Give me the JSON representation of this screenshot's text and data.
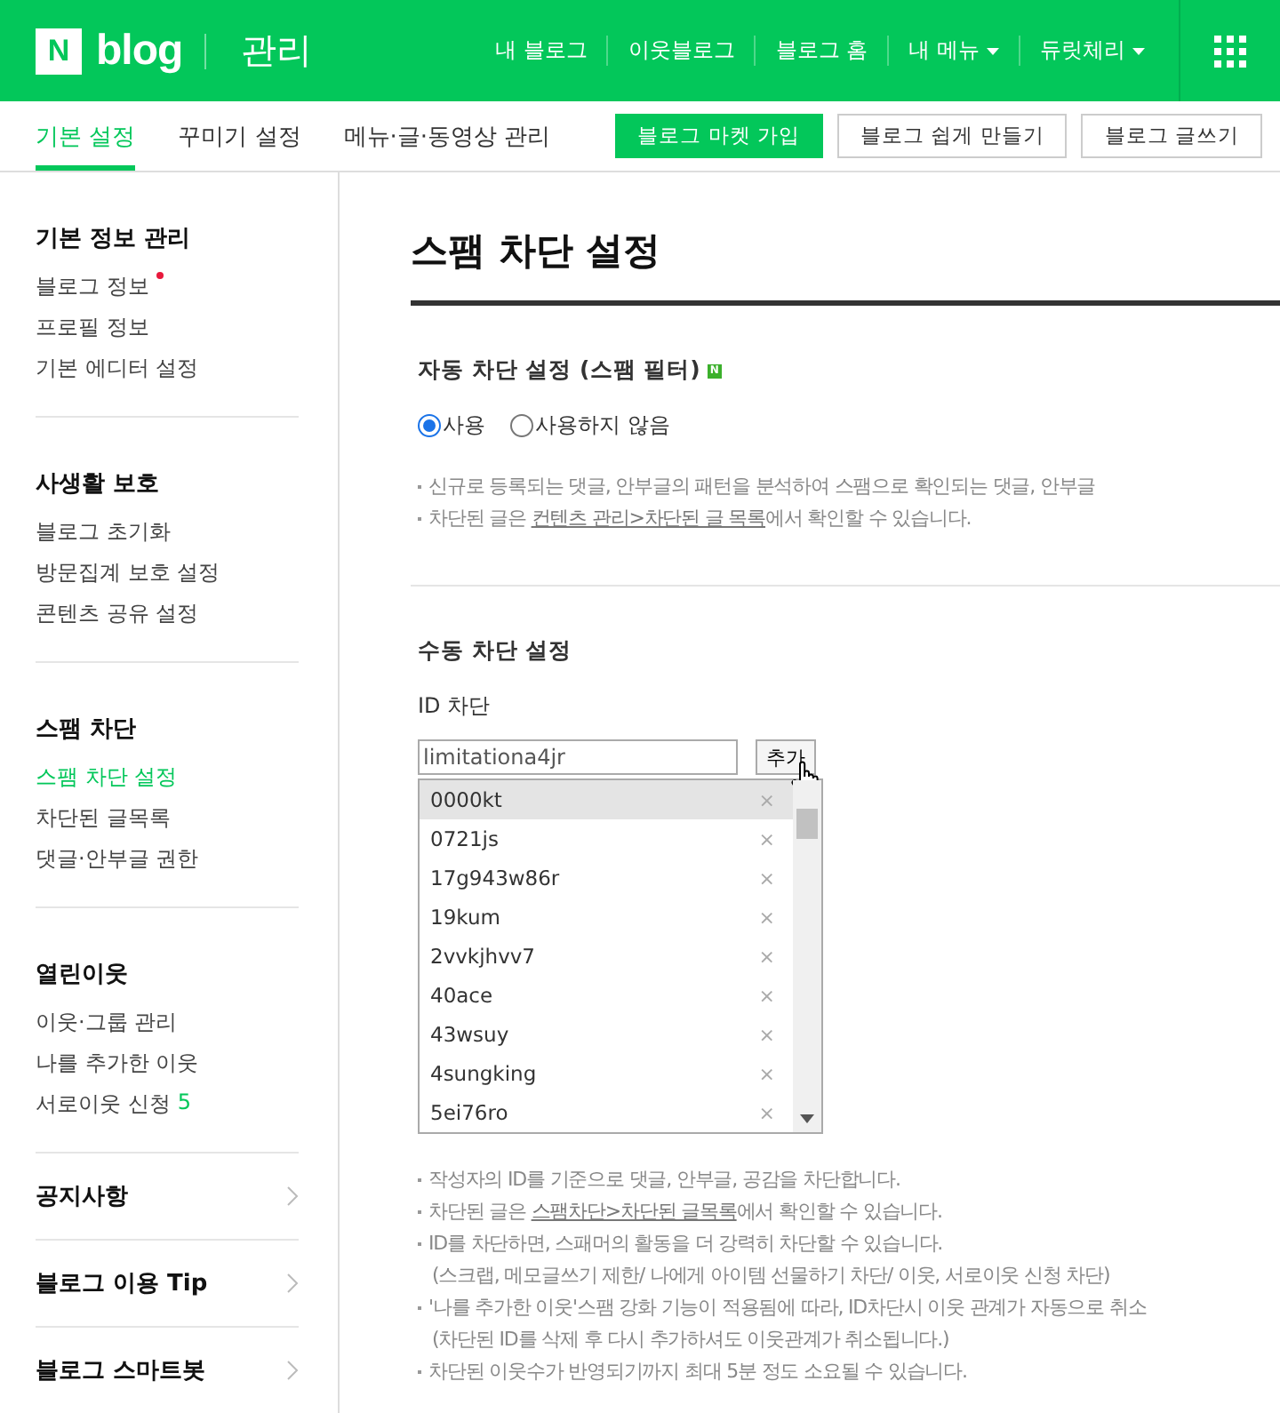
{
  "header": {
    "logo_mark": "N",
    "logo_text": "blog",
    "section": "관리",
    "links": [
      {
        "label": "내 블로그",
        "dropdown": false
      },
      {
        "label": "이웃블로그",
        "dropdown": false
      },
      {
        "label": "블로그 홈",
        "dropdown": false
      },
      {
        "label": "내 메뉴",
        "dropdown": true
      },
      {
        "label": "듀릿체리",
        "dropdown": true
      }
    ]
  },
  "tabs": [
    {
      "label": "기본 설정",
      "selected": true
    },
    {
      "label": "꾸미기 설정",
      "selected": false
    },
    {
      "label": "메뉴·글·동영상 관리",
      "selected": false
    }
  ],
  "actions": [
    {
      "label": "블로그 마켓 가입",
      "primary": true
    },
    {
      "label": "블로그 쉽게 만들기",
      "primary": false
    },
    {
      "label": "블로그 글쓰기",
      "primary": false
    }
  ],
  "sidebar": {
    "groups": [
      {
        "title": "기본 정보 관리",
        "items": [
          {
            "label": "블로그 정보",
            "selected": false,
            "new": true
          },
          {
            "label": "프로필 정보",
            "selected": false,
            "new": false
          },
          {
            "label": "기본 에디터 설정",
            "selected": false,
            "new": false
          }
        ]
      },
      {
        "title": "사생활 보호",
        "items": [
          {
            "label": "블로그 초기화",
            "selected": false,
            "new": false
          },
          {
            "label": "방문집계 보호 설정",
            "selected": false,
            "new": false
          },
          {
            "label": "콘텐츠 공유 설정",
            "selected": false,
            "new": false
          }
        ]
      },
      {
        "title": "스팸 차단",
        "items": [
          {
            "label": "스팸 차단 설정",
            "selected": true,
            "new": false
          },
          {
            "label": "차단된 글목록",
            "selected": false,
            "new": false
          },
          {
            "label": "댓글·안부글 권한",
            "selected": false,
            "new": false
          }
        ]
      },
      {
        "title": "열린이웃",
        "items": [
          {
            "label": "이웃·그룹 관리",
            "selected": false,
            "new": false
          },
          {
            "label": "나를 추가한 이웃",
            "selected": false,
            "new": false
          },
          {
            "label": "서로이웃 신청",
            "selected": false,
            "new": false,
            "count": "5"
          }
        ]
      }
    ],
    "links": [
      "공지사항",
      "블로그 이용 Tip",
      "블로그 스마트봇"
    ]
  },
  "page_title": "스팸 차단 설정",
  "auto_block": {
    "title": "자동 차단 설정 (스팸 필터)",
    "badge": "N",
    "options": [
      {
        "label": "사용",
        "selected": true
      },
      {
        "label": "사용하지 않음",
        "selected": false
      }
    ],
    "notes": [
      {
        "text": "신규로 등록되는 댓글, 안부글의 패턴을 분석하여 스팸으로 확인되는 댓글, 안부글"
      },
      {
        "text": "차단된 글은 ",
        "link": "컨텐츠 관리>차단된 글 목록",
        "after": "에서 확인할 수 있습니다."
      }
    ]
  },
  "manual_block": {
    "title": "수동 차단 설정",
    "id_label": "ID 차단",
    "input_value": "limitationa4jr",
    "add_button": "추가",
    "ids": [
      {
        "id": "0000kt",
        "selected": true
      },
      {
        "id": "0721js",
        "selected": false
      },
      {
        "id": "17g943w86r",
        "selected": false
      },
      {
        "id": "19kum",
        "selected": false
      },
      {
        "id": "2vvkjhvv7",
        "selected": false
      },
      {
        "id": "40ace",
        "selected": false
      },
      {
        "id": "43wsuy",
        "selected": false
      },
      {
        "id": "4sungking",
        "selected": false
      },
      {
        "id": "5ei76ro",
        "selected": false
      }
    ],
    "remove_glyph": "×",
    "notes": [
      {
        "kind": "bullet",
        "text": "작성자의 ID를 기준으로 댓글, 안부글, 공감을 차단합니다."
      },
      {
        "kind": "bullet",
        "text": "차단된 글은 ",
        "link": "스팸차단>차단된 글목록",
        "after": "에서 확인할 수 있습니다."
      },
      {
        "kind": "bullet",
        "text": "ID를 차단하면, 스패머의 활동을 더 강력히 차단할 수 있습니다."
      },
      {
        "kind": "continuation",
        "text": "(스크랩, 메모글쓰기 제한/ 나에게 아이템 선물하기 차단/ 이웃, 서로이웃 신청 차단)"
      },
      {
        "kind": "bullet",
        "text": "'나를 추가한 이웃'스팸 강화 기능이 적용됨에 따라, ID차단시 이웃 관계가 자동으로 취소"
      },
      {
        "kind": "continuation",
        "text": "(차단된 ID를 삭제 후 다시 추가하셔도 이웃관계가 취소됩니다.)"
      },
      {
        "kind": "bullet",
        "text": "차단된 이웃수가 반영되기까지 최대 5분 정도 소요될 수 있습니다."
      }
    ]
  }
}
